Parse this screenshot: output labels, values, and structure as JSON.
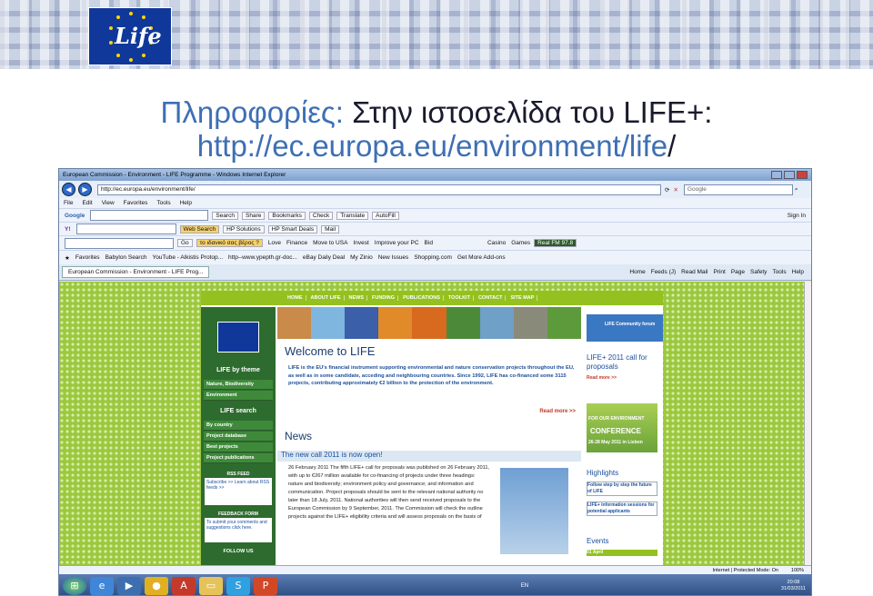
{
  "slide": {
    "title_part1": "Πληροφορίες:",
    "title_part2": "Στην ιστοσελίδα του LIFE+:",
    "url_part1": "http://ec.europa.eu/environment/life",
    "url_part2": "/"
  },
  "logo": {
    "text": "Life"
  },
  "browser": {
    "window_title": "European Commission - Environment - LIFE Programme - Windows Internet Explorer",
    "address": "http://ec.europa.eu/environment/life/",
    "search_engine": "Google",
    "menu": [
      "File",
      "Edit",
      "View",
      "Favorites",
      "Tools",
      "Help"
    ],
    "toolbar1": {
      "brand": "Google",
      "search": "Search",
      "share": "Share",
      "bookmarks": "Bookmarks",
      "check": "Check",
      "translate": "Translate",
      "autofill": "AutoFill",
      "sign_in": "Sign In"
    },
    "toolbar2": {
      "web_search": "Web Search",
      "hp_solutions": "HP Solutions",
      "hp_smart_deals": "HP Smart Deals",
      "mail": "Mail"
    },
    "toolbar3": {
      "go": "Go",
      "greek_search": "το ιδανικό σας βέρος ?",
      "love": "Love",
      "finance": "Finance",
      "move_to_usa": "Move to USA",
      "invest": "Invest",
      "improve_pc": "Improve your PC",
      "bid": "Bid",
      "casino": "Casino",
      "games": "Games",
      "radio": "Real FM 97.8"
    },
    "favorites_bar": [
      "Favorites",
      "Babylon Search",
      "YouTube - Alkistis Protop...",
      "http--www.ypepth.gr-doc...",
      "eBay Daily Deal",
      "My Zinio",
      "New Issues",
      "Shopping.com",
      "Get More Add-ons"
    ],
    "tab_title": "European Commission - Environment - LIFE Prog...",
    "command_bar": [
      "Home",
      "Feeds (J)",
      "Read Mail",
      "Print",
      "Page",
      "Safety",
      "Tools",
      "Help"
    ],
    "status": {
      "zone": "Internet | Protected Mode: On",
      "zoom": "100%"
    }
  },
  "site": {
    "nav": [
      "HOME",
      "ABOUT LIFE",
      "NEWS",
      "FUNDING",
      "PUBLICATIONS",
      "TOOLKIT",
      "CONTACT",
      "SITE MAP"
    ],
    "left": {
      "theme_heading": "LIFE by theme",
      "theme_items": [
        "Nature, Biodiversity",
        "Environment"
      ],
      "search_heading": "LIFE search",
      "search_items": [
        "By country",
        "Project database",
        "Best projects",
        "Project publications"
      ],
      "rss_heading": "RSS FEED",
      "rss_text": "Subscribe >> Learn about RSS feeds >>",
      "feedback_heading": "FEEDBACK FORM",
      "feedback_text": "To submit your comments and suggestions click here.",
      "follow": "FOLLOW US"
    },
    "welcome": "Welcome to LIFE",
    "intro": "LIFE is the EU's financial instrument supporting environmental and nature conservation projects throughout the EU, as well as in some candidate, acceding and neighbouring countries. Since 1992, LIFE has co-financed some 3115 projects, contributing approximately €2 billion to the protection of the environment.",
    "read_more": "Read more >>",
    "news": "News",
    "call_heading": "The new call 2011 is now open!",
    "call_text": "26 February 2011 The fifth LIFE+ call for proposals was published on 26 February 2011, with up to €267 million available for co-financing of projects under three headings: nature and biodiversity; environment policy and governance; and information and communication. Project proposals should be sent to the relevant national authority no later than 18 July, 2011. National authorities will then send received proposals to the European Commission by 9 September, 2011. The Commission will check the outline projects against the LIFE+ eligibility criteria and will assess proposals on the basis of",
    "right": {
      "forum": "LIFE Community forum",
      "call": "LIFE+ 2011 call for proposals",
      "read_more": "Read more >>",
      "conference": "CONFERENCE",
      "conference_sub": "FOR OUR ENVIRONMENT",
      "conference_date": "26-28 May 2011 in Lisbon",
      "highlights": "Highlights",
      "h1": "Follow step by step the future of LIFE",
      "h2": "LIFE+ information sessions for potential applicants",
      "events": "Events",
      "april": "01 April"
    }
  },
  "taskbar": {
    "lang": "EN",
    "time": "20:08",
    "date": "31/03/2011"
  }
}
